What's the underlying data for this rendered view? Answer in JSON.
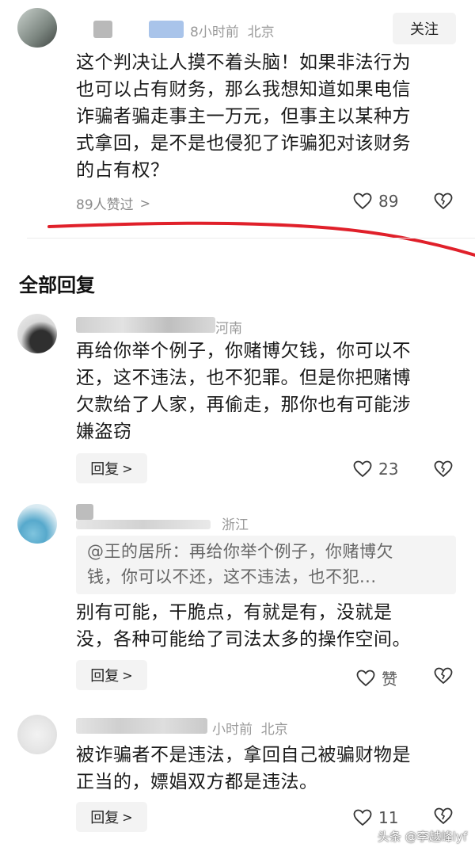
{
  "top_comment": {
    "meta": "8小时前  北京",
    "follow_label": "关注",
    "lines": [
      "这个判决让人摸不着头脑！如果非法行为",
      "也可以占有财务，那么我想知道如果电信",
      "诈骗者骗走事主一万元，但事主以某种方",
      "式拿回，是不是也侵犯了诈骗犯对该财务",
      "的占有权？"
    ],
    "likers": "89人赞过",
    "likes": "89"
  },
  "section_title": "全部回复",
  "replies": [
    {
      "meta": "河南",
      "lines": [
        "再给你举个例子，你赌博欠钱，你可以不",
        "还，这不违法，也不犯罪。但是你把赌博",
        "欠款给了人家，再偷走，那你也有可能涉",
        "嫌盗窃"
      ],
      "reply_label": "回复",
      "likes": "23"
    },
    {
      "meta": "浙江",
      "quote_lines": [
        "@王的居所：再给你举个例子，你赌博欠",
        "钱，你可以不还，这不违法，也不犯..."
      ],
      "lines": [
        "别有可能，干脆点，有就是有，没就是",
        "没，各种可能给了司法太多的操作空间。"
      ],
      "reply_label": "回复",
      "likes": "赞"
    },
    {
      "meta": "小时前  北京",
      "lines": [
        "被诈骗者不是违法，拿回自己被骗财物是",
        "正当的，嫖娼双方都是违法。"
      ],
      "reply_label": "回复",
      "likes": "11"
    }
  ],
  "watermark": "头条 @李越峰lyf",
  "colors": {
    "annotation_red": "#e0202a",
    "reply_button_bg": "#f3f3f3",
    "quote_bg": "#f4f4f4"
  }
}
